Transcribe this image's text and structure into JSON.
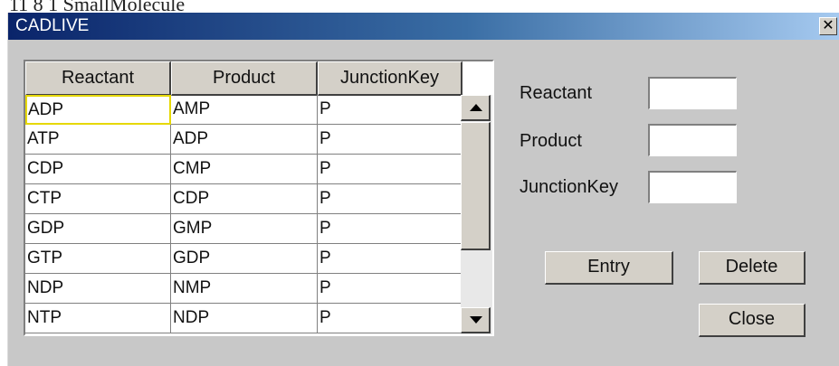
{
  "above": {
    "text": "11 8   1 SmallMolecule"
  },
  "window": {
    "title": "CADLIVE",
    "close_label": "✕"
  },
  "table": {
    "columns": [
      "Reactant",
      "Product",
      "JunctionKey"
    ],
    "rows": [
      [
        "ADP",
        "AMP",
        "P"
      ],
      [
        "ATP",
        "ADP",
        "P"
      ],
      [
        "CDP",
        "CMP",
        "P"
      ],
      [
        "CTP",
        "CDP",
        "P"
      ],
      [
        "GDP",
        "GMP",
        "P"
      ],
      [
        "GTP",
        "GDP",
        "P"
      ],
      [
        "NDP",
        "NMP",
        "P"
      ],
      [
        "NTP",
        "NDP",
        "P"
      ]
    ],
    "selected_cell": "row 1, Reactant"
  },
  "form": {
    "reactant_label": "Reactant",
    "reactant_value": "",
    "product_label": "Product",
    "product_value": "",
    "junction_label": "JunctionKey",
    "junction_value": ""
  },
  "buttons": {
    "entry": "Entry",
    "delete": "Delete",
    "close": "Close"
  },
  "icons": {
    "scroll_up": "triangle-up-icon",
    "scroll_down": "triangle-down-icon",
    "window_close": "close-icon"
  },
  "colors": {
    "title_start": "#0a246a",
    "title_end": "#a6caf0",
    "dialog_bg": "#c8c8c8",
    "selection_border": "#e6d800"
  }
}
